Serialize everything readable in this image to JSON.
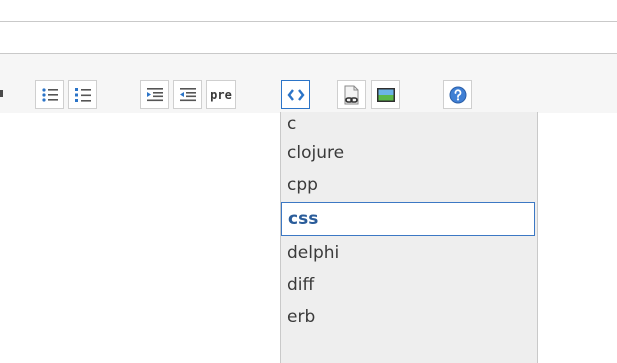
{
  "toolbar": {
    "pre_label": "pre",
    "accent_color": "#2b74c8"
  },
  "dropdown": {
    "items": [
      "c",
      "clojure",
      "cpp",
      "css",
      "delphi",
      "diff",
      "erb"
    ],
    "selected": "css"
  }
}
